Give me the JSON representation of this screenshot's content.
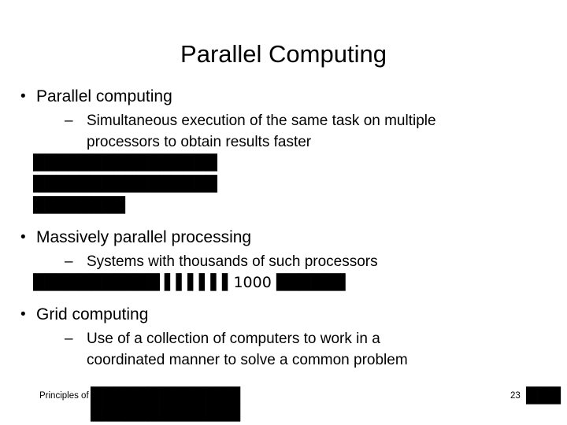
{
  "slide": {
    "title": "Parallel Computing",
    "bullet_glyph": "•",
    "dash_glyph": "–",
    "items": [
      {
        "level1": "Parallel computing",
        "level2_lines": [
          "Simultaneous execution of the same task on multiple",
          "processors to obtain results faster"
        ],
        "box_rows": [
          "████████████████",
          "████████████████",
          "████████"
        ]
      },
      {
        "level1": "Massively parallel processing",
        "level2_lines": [
          "Systems with thousands of such processors"
        ],
        "box_rows": [
          "███████████ ▌▌▌▌▌▌1000 ██████"
        ]
      },
      {
        "level1": "Grid computing",
        "level2_lines": [
          "Use of a collection of computers to work in a",
          "coordinated manner to solve a common problem"
        ],
        "box_rows": []
      }
    ]
  },
  "footer": {
    "text": "Principles of Information Systems, Ninth Edition",
    "boxes": "█████████████",
    "page_number": "23",
    "page_boxes": "███",
    "bottom_boxes": "█████████████"
  }
}
